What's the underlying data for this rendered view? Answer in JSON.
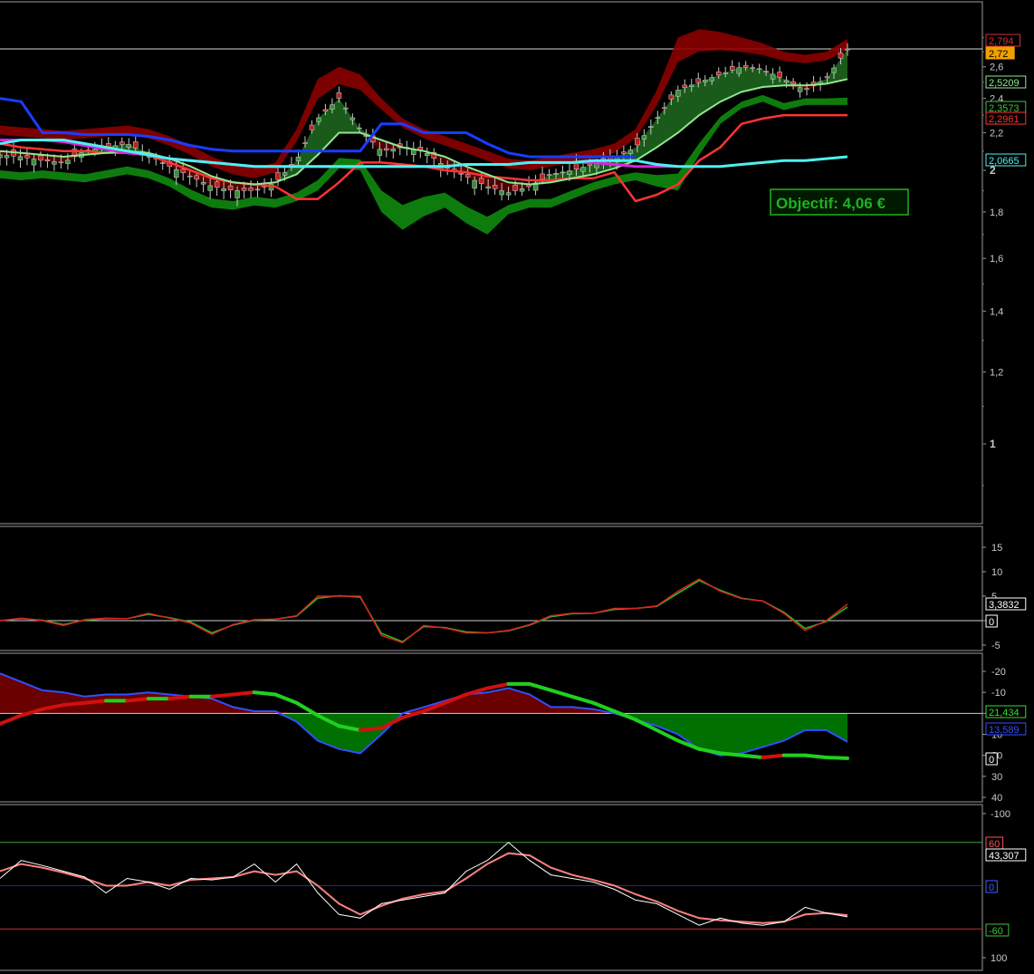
{
  "colors": {
    "bg": "#000000",
    "frame": "#9a9a9a",
    "up_candle": "#3a8f3a",
    "down_candle": "#c02020",
    "upper_band": "#8b0000",
    "lower_band": "#0e8a0e",
    "ma_fast": "#8fe88f",
    "ma_red": "#ff3333",
    "stop_blue": "#1a3cff",
    "ma_cyan": "#4ef0f0",
    "ma_magenta": "#e020e0",
    "osc_green": "#00b000",
    "osc_red": "#d01010",
    "macd_fill_pos": "#007000",
    "macd_fill_neg": "#6a0000",
    "rsi_line": "#ffffff",
    "rsi_avg": "#ff8080",
    "level_red": "#c03030",
    "level_blue": "#2020c0",
    "level_green": "#40a040"
  },
  "price_panel": {
    "y_ticks": [
      "2,6",
      "2,4",
      "2,2",
      "2",
      "1,8",
      "1,6",
      "1,4",
      "1,2",
      "1"
    ],
    "bold_ticks": [
      "2",
      "1"
    ],
    "tags": [
      {
        "name": "upper-band-tag",
        "text": "2,794",
        "color": "#d03030",
        "fill": "#000000"
      },
      {
        "name": "last-price-tag",
        "text": "2,72",
        "color": "#000000",
        "fill": "#f0a000"
      },
      {
        "name": "fast-ma-tag",
        "text": "2,5209",
        "color": "#8fe88f",
        "fill": "#000000"
      },
      {
        "name": "lower-band-tag",
        "text": "2,3573",
        "color": "#40c040",
        "fill": "#000000"
      },
      {
        "name": "red-ma-tag",
        "text": "2,2961",
        "color": "#ff3333",
        "fill": "#000000"
      },
      {
        "name": "cyan-ma-tag",
        "text": "2,0665",
        "color": "#4ef0f0",
        "fill": "#000000"
      }
    ],
    "objectif_label": "Objectif: 4,06 €"
  },
  "momentum_panel": {
    "y_ticks": [
      "15",
      "10",
      "5",
      "0",
      "-5"
    ],
    "tags": [
      {
        "name": "momentum-value-tag",
        "text": "3,3832",
        "color": "#ffffff",
        "fill": "#000000"
      },
      {
        "name": "momentum-zero-tag",
        "text": "0",
        "color": "#ffffff",
        "fill": "#000000"
      }
    ]
  },
  "macd_panel": {
    "y_ticks": [
      "40",
      "30",
      "20",
      "10",
      "0",
      "-10",
      "-20"
    ],
    "tags": [
      {
        "name": "macd-signal-tag",
        "text": "21,434",
        "color": "#30e030",
        "fill": "#000000"
      },
      {
        "name": "macd-line-tag",
        "text": "13,589",
        "color": "#3050ff",
        "fill": "#000000"
      },
      {
        "name": "macd-zero-tag",
        "text": "0",
        "color": "#ffffff",
        "fill": "#000000"
      }
    ]
  },
  "rsi_panel": {
    "y_ticks": [
      "100",
      "-100"
    ],
    "tags": [
      {
        "name": "rsi-upper-level-tag",
        "text": "60",
        "color": "#ff5050",
        "fill": "#000000"
      },
      {
        "name": "rsi-value-tag",
        "text": "43,307",
        "color": "#ffffff",
        "fill": "#000000"
      },
      {
        "name": "rsi-mid-level-tag",
        "text": "0",
        "color": "#4060ff",
        "fill": "#000000"
      },
      {
        "name": "rsi-lower-level-tag",
        "text": "-60",
        "color": "#40c040",
        "fill": "#000000"
      }
    ]
  },
  "chart_data": [
    {
      "type": "line",
      "panel": "price",
      "scale": "log",
      "ylim": [
        0.8,
        3.2
      ],
      "x": [
        0,
        5,
        10,
        15,
        20,
        25,
        30,
        35,
        40,
        45,
        50,
        55,
        60,
        65,
        70,
        75,
        80,
        85,
        90,
        95,
        100,
        105,
        110,
        115,
        120,
        125,
        130,
        135,
        140,
        145,
        150,
        155,
        160,
        165,
        170,
        175,
        180,
        185,
        190,
        195,
        200
      ],
      "series": [
        {
          "name": "close",
          "values": [
            2.08,
            2.07,
            2.05,
            2.04,
            2.1,
            2.12,
            2.14,
            2.08,
            2.02,
            1.97,
            1.92,
            1.9,
            1.9,
            1.94,
            2.05,
            2.28,
            2.4,
            2.22,
            2.1,
            2.12,
            2.1,
            2.02,
            1.97,
            1.92,
            1.89,
            1.92,
            1.98,
            2.0,
            2.03,
            2.06,
            2.12,
            2.28,
            2.45,
            2.5,
            2.55,
            2.6,
            2.58,
            2.52,
            2.45,
            2.52,
            2.72
          ]
        },
        {
          "name": "upper_band",
          "values": [
            2.24,
            2.23,
            2.22,
            2.21,
            2.22,
            2.23,
            2.24,
            2.22,
            2.18,
            2.13,
            2.07,
            2.03,
            2.01,
            2.04,
            2.22,
            2.52,
            2.6,
            2.55,
            2.4,
            2.28,
            2.22,
            2.18,
            2.14,
            2.1,
            2.06,
            2.05,
            2.07,
            2.09,
            2.11,
            2.14,
            2.22,
            2.45,
            2.8,
            2.86,
            2.84,
            2.8,
            2.76,
            2.7,
            2.68,
            2.7,
            2.79
          ]
        },
        {
          "name": "lower_band",
          "values": [
            1.96,
            1.95,
            1.96,
            1.95,
            1.94,
            1.96,
            1.98,
            1.96,
            1.92,
            1.86,
            1.82,
            1.81,
            1.83,
            1.82,
            1.85,
            1.9,
            2.01,
            2.0,
            1.8,
            1.72,
            1.78,
            1.82,
            1.75,
            1.7,
            1.79,
            1.82,
            1.82,
            1.86,
            1.9,
            1.93,
            1.95,
            1.92,
            1.9,
            2.08,
            2.25,
            2.34,
            2.38,
            2.33,
            2.36,
            2.36,
            2.36
          ]
        },
        {
          "name": "fast_ma",
          "values": [
            2.1,
            2.09,
            2.08,
            2.07,
            2.08,
            2.09,
            2.1,
            2.09,
            2.06,
            2.02,
            1.97,
            1.94,
            1.93,
            1.94,
            1.98,
            2.08,
            2.2,
            2.2,
            2.16,
            2.12,
            2.1,
            2.07,
            2.02,
            1.98,
            1.94,
            1.93,
            1.94,
            1.96,
            1.98,
            2.01,
            2.05,
            2.12,
            2.2,
            2.3,
            2.38,
            2.44,
            2.47,
            2.48,
            2.48,
            2.49,
            2.52
          ]
        },
        {
          "name": "red_ma",
          "values": [
            2.14,
            2.12,
            2.11,
            2.1,
            2.1,
            2.09,
            2.09,
            2.08,
            2.04,
            2.0,
            1.96,
            1.94,
            1.93,
            1.92,
            1.86,
            1.86,
            1.94,
            2.04,
            2.04,
            2.03,
            2.02,
            2.0,
            1.99,
            1.97,
            1.96,
            1.95,
            1.95,
            1.96,
            1.96,
            1.99,
            1.85,
            1.88,
            1.93,
            2.05,
            2.12,
            2.25,
            2.28,
            2.3,
            2.3,
            2.3,
            2.3
          ]
        },
        {
          "name": "stop_blue",
          "values": [
            2.4,
            2.38,
            2.2,
            2.2,
            2.19,
            2.19,
            2.19,
            2.18,
            2.16,
            2.13,
            2.11,
            2.1,
            2.1,
            2.1,
            2.1,
            2.1,
            2.1,
            2.1,
            2.25,
            2.25,
            2.2,
            2.2,
            2.2,
            2.14,
            2.09,
            2.07,
            2.07,
            2.07,
            2.07,
            2.07,
            2.07,
            null,
            null,
            null,
            null,
            null,
            null,
            null,
            null,
            null,
            null
          ]
        },
        {
          "name": "cyan_ma",
          "values": [
            2.14,
            2.16,
            2.16,
            2.16,
            2.14,
            2.12,
            2.1,
            2.08,
            2.06,
            2.05,
            2.04,
            2.03,
            2.02,
            2.02,
            2.02,
            2.02,
            2.02,
            2.02,
            2.02,
            2.02,
            2.02,
            2.02,
            2.03,
            2.03,
            2.03,
            2.04,
            2.04,
            2.04,
            2.05,
            2.05,
            2.05,
            2.03,
            2.02,
            2.02,
            2.02,
            2.03,
            2.04,
            2.05,
            2.05,
            2.06,
            2.07
          ]
        },
        {
          "name": "magenta_ma",
          "values": [
            2.16,
            2.16,
            2.16,
            2.15,
            2.13,
            2.11,
            2.09,
            2.08,
            2.06,
            2.05,
            2.04,
            2.03,
            2.02,
            2.02,
            2.02,
            2.02,
            2.02,
            2.02,
            2.02,
            2.02,
            2.02,
            2.02,
            2.03,
            2.03,
            2.03,
            2.04,
            2.04,
            2.04,
            2.04,
            2.03,
            2.02,
            2.02,
            2.02,
            null,
            null,
            null,
            null,
            null,
            null,
            null,
            null
          ]
        }
      ]
    },
    {
      "type": "line",
      "panel": "momentum",
      "ylim": [
        -7,
        18
      ],
      "x": [
        0,
        5,
        10,
        15,
        20,
        25,
        30,
        35,
        40,
        45,
        50,
        55,
        60,
        65,
        70,
        75,
        80,
        85,
        90,
        95,
        100,
        105,
        110,
        115,
        120,
        125,
        130,
        135,
        140,
        145,
        150,
        155,
        160,
        165,
        170,
        175,
        180,
        185,
        190,
        195,
        200
      ],
      "series": [
        {
          "name": "momentum",
          "values": [
            0,
            0.5,
            0,
            -1,
            0.2,
            0.5,
            0.4,
            1.5,
            0.5,
            -0.5,
            -2.8,
            -0.8,
            0.2,
            0.3,
            1,
            5,
            5,
            5,
            -3,
            -4.5,
            -1,
            -1.5,
            -2.5,
            -2.5,
            -2,
            -0.8,
            1,
            1.5,
            1.5,
            2.5,
            2.5,
            3,
            6,
            8.5,
            6,
            4.5,
            4,
            1.5,
            -2,
            0,
            3.38
          ]
        },
        {
          "name": "momentum_signal",
          "values": [
            0,
            0.4,
            0.1,
            -0.8,
            0.1,
            0.4,
            0.4,
            1.3,
            0.6,
            -0.3,
            -2.5,
            -0.9,
            0.1,
            0.3,
            0.9,
            4.6,
            5.1,
            4.8,
            -2.6,
            -4.3,
            -1.2,
            -1.4,
            -2.3,
            -2.5,
            -2.1,
            -0.9,
            0.8,
            1.4,
            1.5,
            2.3,
            2.5,
            2.9,
            5.6,
            8.2,
            6.2,
            4.6,
            4,
            1.7,
            -1.6,
            -0.2,
            2.8
          ]
        }
      ]
    },
    {
      "type": "area",
      "panel": "macd",
      "ylim": [
        -23,
        46
      ],
      "x": [
        0,
        5,
        10,
        15,
        20,
        25,
        30,
        35,
        40,
        45,
        50,
        55,
        60,
        65,
        70,
        75,
        80,
        85,
        90,
        95,
        100,
        105,
        110,
        115,
        120,
        125,
        130,
        135,
        140,
        145,
        150,
        155,
        160,
        165,
        170,
        175,
        180,
        185,
        190,
        195,
        200
      ],
      "series": [
        {
          "name": "macd_line",
          "values": [
            -19,
            -15,
            -11,
            -10,
            -8,
            -9,
            -9,
            -10,
            -9,
            -8,
            -7,
            -3,
            -1,
            -1,
            4,
            13,
            17,
            19,
            10,
            0,
            -3,
            -6,
            -9,
            -10,
            -12,
            -9,
            -3,
            -3,
            -2,
            0,
            3,
            6,
            10,
            17,
            20,
            19,
            16,
            13,
            8,
            8,
            13.6
          ]
        },
        {
          "name": "macd_signal",
          "values": [
            5,
            1,
            -2,
            -4,
            -5,
            -6,
            -6,
            -7,
            -7,
            -8,
            -8,
            -9,
            -10,
            -9,
            -5,
            1,
            6,
            8,
            7,
            2,
            -1,
            -5,
            -9,
            -12,
            -14,
            -14,
            -11,
            -8,
            -5,
            -1,
            3,
            8,
            13,
            17,
            19,
            20,
            21,
            20,
            20,
            21,
            21.4
          ]
        }
      ]
    },
    {
      "type": "line",
      "panel": "rsi",
      "ylim": [
        -110,
        110
      ],
      "levels": [
        60,
        0,
        -60
      ],
      "x": [
        0,
        5,
        10,
        15,
        20,
        25,
        30,
        35,
        40,
        45,
        50,
        55,
        60,
        65,
        70,
        75,
        80,
        85,
        90,
        95,
        100,
        105,
        110,
        115,
        120,
        125,
        130,
        135,
        140,
        145,
        150,
        155,
        160,
        165,
        170,
        175,
        180,
        185,
        190,
        195,
        200
      ],
      "series": [
        {
          "name": "rsi",
          "values": [
            -10,
            -35,
            -28,
            -20,
            -12,
            10,
            -10,
            -5,
            5,
            -10,
            -8,
            -12,
            -30,
            -5,
            -30,
            10,
            40,
            45,
            25,
            20,
            15,
            10,
            -20,
            -35,
            -60,
            -35,
            -15,
            -10,
            -5,
            5,
            20,
            25,
            40,
            55,
            45,
            52,
            55,
            50,
            30,
            38,
            43.3
          ]
        },
        {
          "name": "rsi_avg",
          "values": [
            -20,
            -30,
            -25,
            -18,
            -10,
            0,
            0,
            -5,
            0,
            -8,
            -10,
            -12,
            -20,
            -15,
            -20,
            0,
            25,
            40,
            28,
            18,
            12,
            8,
            -10,
            -30,
            -45,
            -42,
            -25,
            -15,
            -8,
            0,
            12,
            22,
            35,
            45,
            48,
            50,
            52,
            50,
            40,
            38,
            41
          ]
        }
      ]
    }
  ]
}
